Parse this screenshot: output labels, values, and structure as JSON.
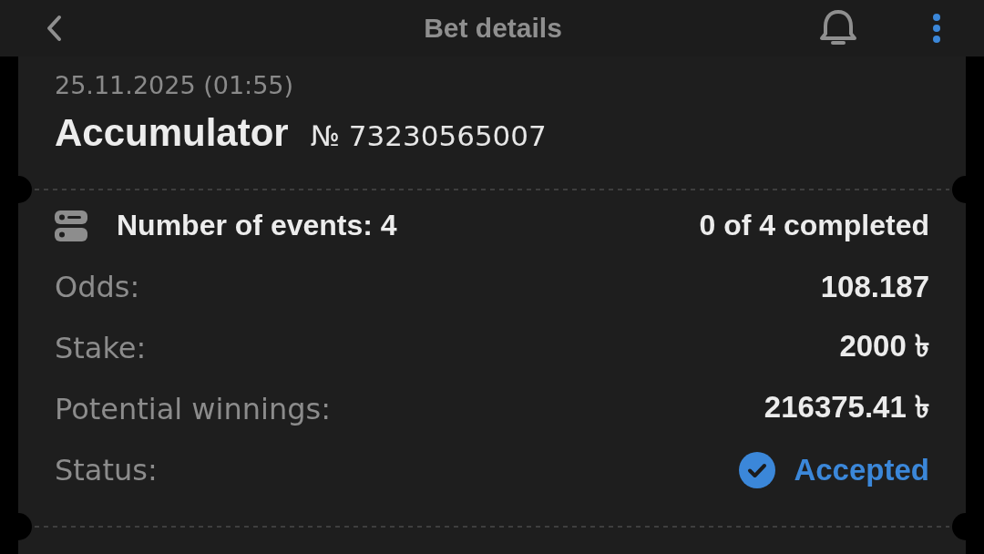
{
  "header": {
    "title": "Bet details"
  },
  "bet": {
    "date": "25.11.2025 (01:55)",
    "type": "Accumulator",
    "number": "№ 73230565007",
    "events_label": "Number of events: 4",
    "events_completed": "0 of 4 completed",
    "details": [
      {
        "kind": "text",
        "label": "Odds:",
        "value": "108.187"
      },
      {
        "kind": "text",
        "label": "Stake:",
        "value": "2000 ৳"
      },
      {
        "kind": "text",
        "label": "Potential winnings:",
        "value": "216375.41 ৳"
      },
      {
        "kind": "status",
        "label": "Status:",
        "value": "Accepted"
      }
    ]
  }
}
